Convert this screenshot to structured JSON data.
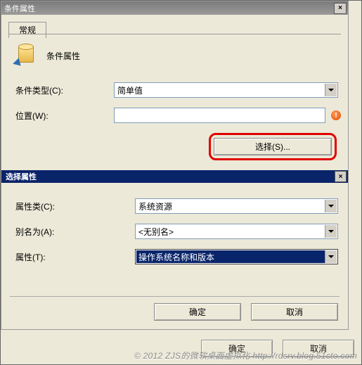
{
  "window": {
    "title": "条件属性"
  },
  "tab": {
    "general": "常规"
  },
  "header": {
    "caption": "条件属性"
  },
  "cond": {
    "type_label": "条件类型(C):",
    "type_value": "简单值",
    "location_label": "位置(W):",
    "location_value": "",
    "choose_btn": "选择(S)..."
  },
  "section": {
    "title": "选择属性"
  },
  "attr": {
    "class_label": "属性类(C):",
    "class_value": "系统资源",
    "alias_label": "别名为(A):",
    "alias_value": "<无别名>",
    "prop_label": "属性(T):",
    "prop_value": "操作系统名称和版本"
  },
  "buttons": {
    "ok": "确定",
    "cancel": "取消"
  },
  "watermark": "© 2012 ZJS的微软桌面虚拟化  http://rdsrv.blog.51cto.com"
}
